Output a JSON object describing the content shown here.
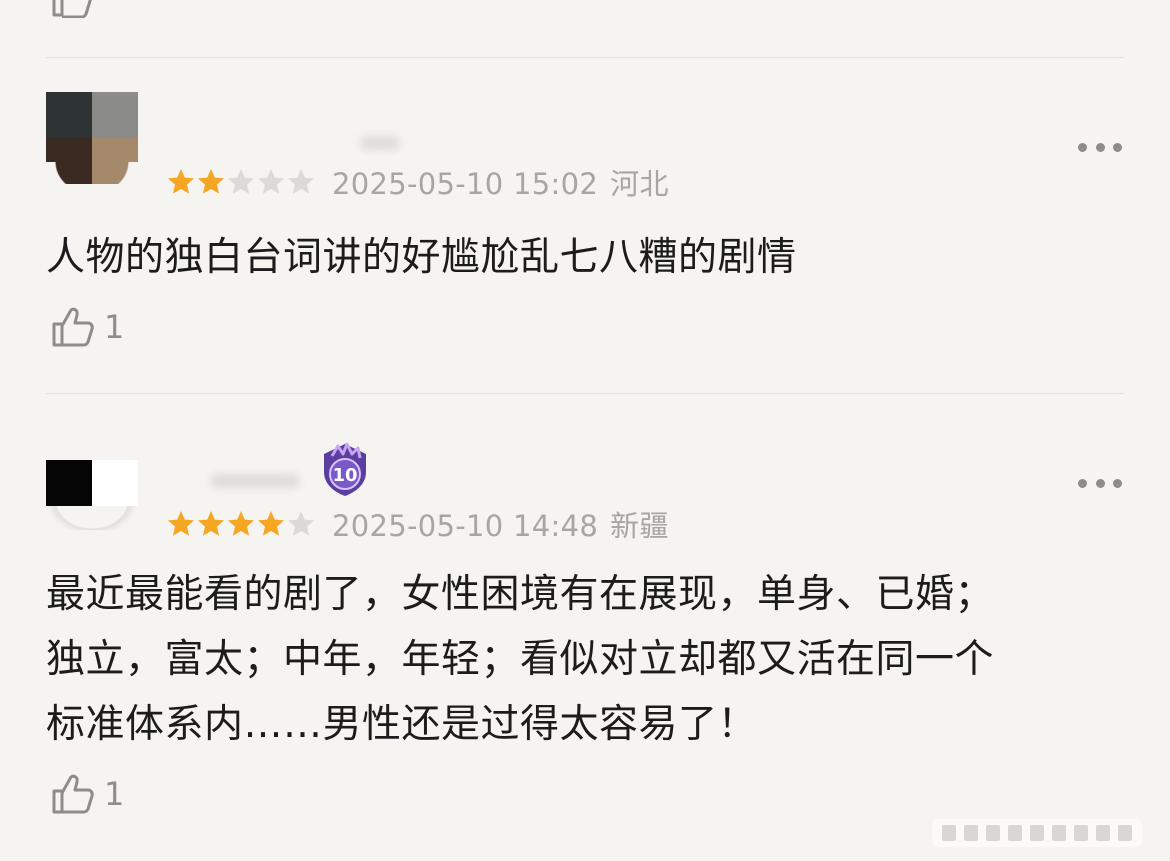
{
  "colors": {
    "background": "#f6f4f0",
    "star_filled": "#f5a623",
    "star_empty": "#dcdad6",
    "meta_text": "#a8a6a2",
    "body_text": "#1c1c1c",
    "badge": "#6b4fb3"
  },
  "previous_comment": {
    "like_icon": "thumbs-up-icon"
  },
  "comments": [
    {
      "rating": 2,
      "rating_max": 5,
      "date": "2025-05-10 15:02",
      "location": "河北",
      "text": "人物的独白台词讲的好尴尬乱七八糟的剧情",
      "likes": "1",
      "more_icon": "more-options-icon",
      "like_icon": "thumbs-up-icon"
    },
    {
      "rating": 4,
      "rating_max": 5,
      "date": "2025-05-10 14:48",
      "location": "新疆",
      "badge_level": "10",
      "text_lines": [
        "最近最能看的剧了，女性困境有在展现，单身、已婚；",
        "独立，富太；中年，年轻；看似对立却都又活在同一个",
        "标准体系内……男性还是过得太容易了！"
      ],
      "likes": "1",
      "more_icon": "more-options-icon",
      "like_icon": "thumbs-up-icon"
    }
  ]
}
